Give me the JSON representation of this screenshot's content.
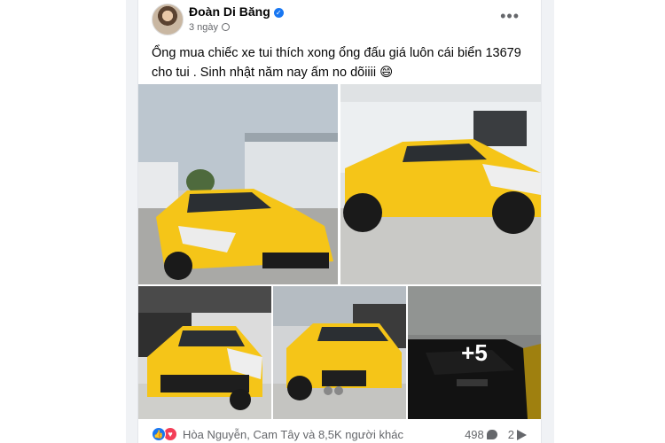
{
  "post": {
    "author": "Đoàn Di Băng",
    "time": "3 ngày",
    "text": "Ổng mua chiếc xe tui thích xong ổng đấu giá luôn cái biển 13679 cho tui . Sinh nhật năm nay ấm no dõiiii 😄",
    "more_photos_label": "+5"
  },
  "reactions": {
    "summary": "Hòa Nguyễn, Cam Tây và 8,5K người khác",
    "comments": "498",
    "shares": "2"
  },
  "icons": {
    "verified": "verified-badge-icon",
    "privacy": "globe-icon",
    "more": "more-options-icon",
    "like": "like-reaction-icon",
    "love": "love-reaction-icon",
    "comment": "comment-icon",
    "share": "share-icon"
  },
  "colors": {
    "accent": "#1877f2",
    "love": "#f33e58",
    "car": "#f5c518",
    "secondary_text": "#65676b"
  }
}
